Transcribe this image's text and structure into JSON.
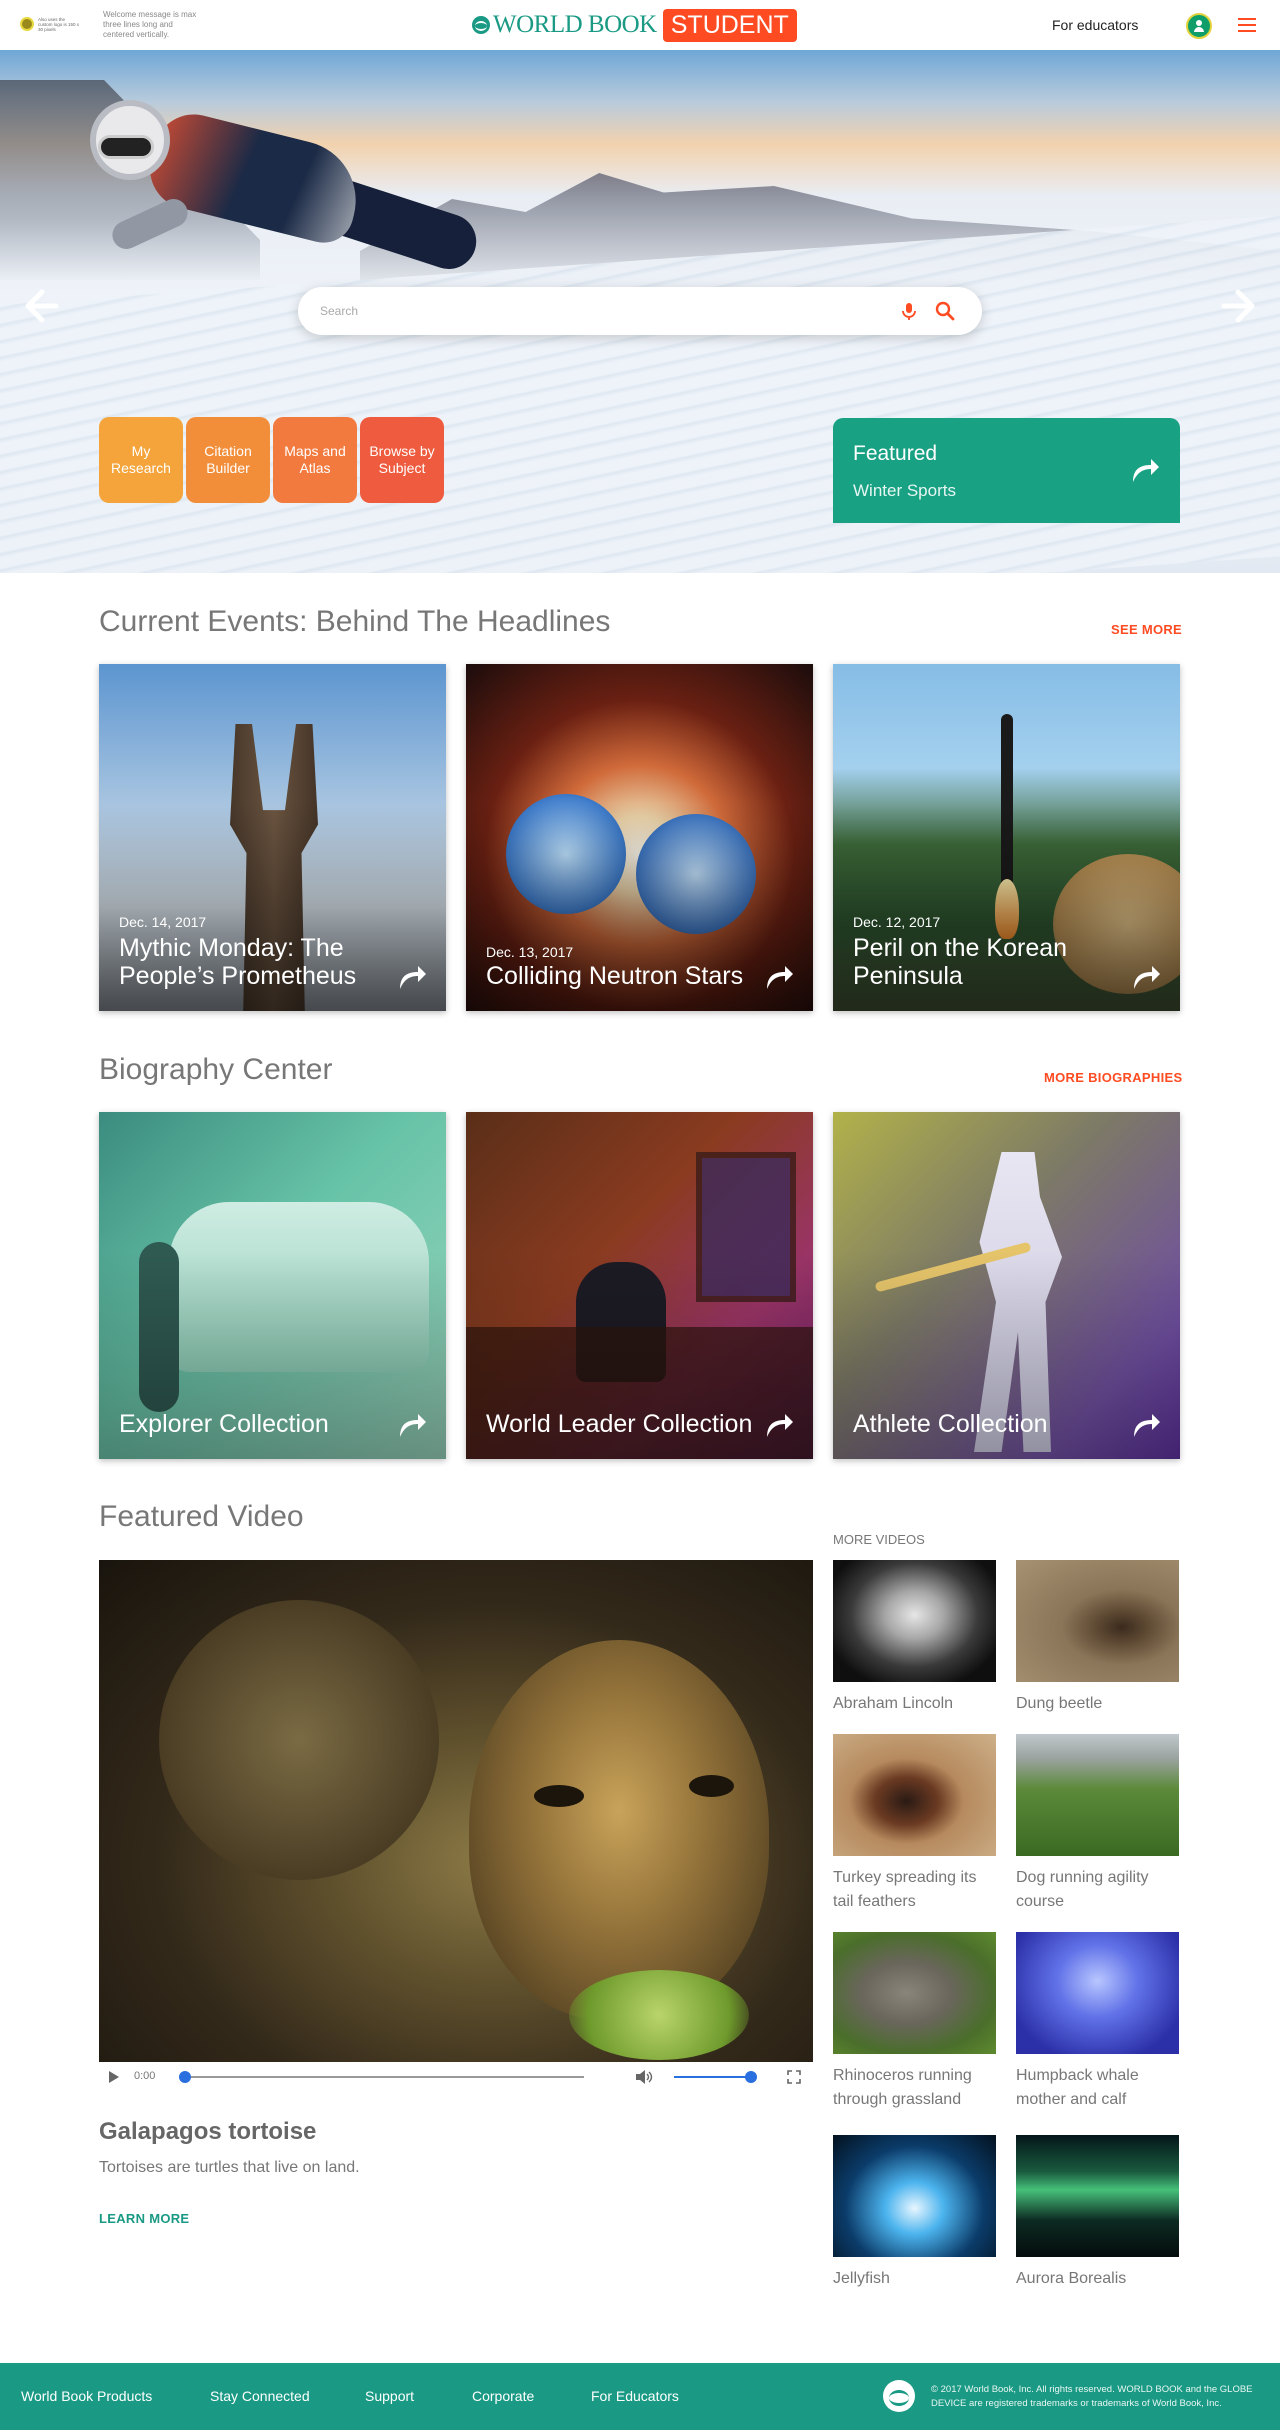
{
  "header": {
    "customer_logo_text": "Also uses the custom logo is 150 x 30 pixels",
    "welcome": "Welcome message is max three lines long and centered vertically.",
    "brand_name": "WORLD BOOK",
    "brand_badge": "STUDENT",
    "for_educators": "For educators"
  },
  "hero": {
    "search_placeholder": "Search",
    "quick_links": [
      "My Research",
      "Citation Builder",
      "Maps and Atlas",
      "Browse by Subject"
    ],
    "featured_label": "Featured",
    "featured_topic": "Winter Sports"
  },
  "current_events": {
    "title": "Current Events: Behind The Headlines",
    "link": "SEE MORE",
    "items": [
      {
        "date": "Dec. 14, 2017",
        "title": "Mythic Monday: The People’s Prometheus"
      },
      {
        "date": "Dec. 13, 2017",
        "title": "Colliding Neutron Stars"
      },
      {
        "date": "Dec. 12, 2017",
        "title": "Peril on the Korean Peninsula"
      }
    ]
  },
  "biography": {
    "title": "Biography Center",
    "link": "MORE BIOGRAPHIES",
    "items": [
      {
        "title": "Explorer Collection"
      },
      {
        "title": "World Leader Collection"
      },
      {
        "title": "Athlete Collection"
      }
    ]
  },
  "video": {
    "section_title": "Featured Video",
    "time": "0:00",
    "title": "Galapagos tortoise",
    "description": "Tortoises are turtles that live on land.",
    "learn_more": "LEARN MORE",
    "more_label": "MORE VIDEOS",
    "more": [
      {
        "caption": "Abraham Lincoln"
      },
      {
        "caption": "Dung beetle"
      },
      {
        "caption": "Turkey spreading its tail feathers"
      },
      {
        "caption": "Dog running agility course"
      },
      {
        "caption": "Rhinoceros running through grassland"
      },
      {
        "caption": "Humpback whale mother and calf"
      },
      {
        "caption": "Jellyfish"
      },
      {
        "caption": "Aurora Borealis"
      }
    ]
  },
  "footer": {
    "links": [
      "World Book Products",
      "Stay Connected",
      "Support",
      "Corporate",
      "For Educators"
    ],
    "copyright": "© 2017 World Book, Inc. All rights reserved. WORLD BOOK and the GLOBE DEVICE are registered trademarks or trademarks of World Book, Inc."
  },
  "colors": {
    "brand_green": "#1a9a84",
    "brand_orange": "#ff4b22",
    "player_blue": "#2a6fe0"
  }
}
